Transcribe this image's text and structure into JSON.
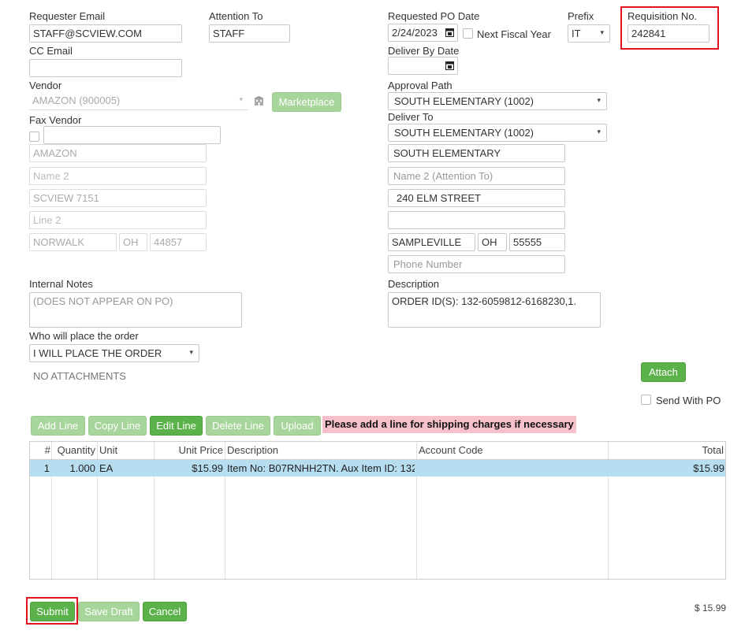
{
  "requester": {
    "email_label": "Requester Email",
    "email_value": "STAFF@SCVIEW.COM",
    "cc_label": "CC Email",
    "cc_value": ""
  },
  "attention": {
    "label": "Attention To",
    "value": "STAFF"
  },
  "po_date": {
    "label": "Requested PO Date",
    "value": "2/24/2023",
    "next_fiscal_label": "Next Fiscal Year"
  },
  "prefix": {
    "label": "Prefix",
    "value": "IT"
  },
  "requisition": {
    "label": "Requisition No.",
    "value": "242841"
  },
  "deliver_by": {
    "label": "Deliver By Date",
    "value": ""
  },
  "vendor": {
    "label": "Vendor",
    "value": "AMAZON (900005)",
    "marketplace_label": "Marketplace",
    "fax_label": "Fax Vendor",
    "fax_value": "",
    "name": "AMAZON",
    "name2_placeholder": "Name 2",
    "line1": "SCVIEW 7151",
    "line2_placeholder": "Line 2",
    "city": "NORWALK",
    "state": "OH",
    "zip": "44857"
  },
  "approval": {
    "label": "Approval Path",
    "value": "SOUTH ELEMENTARY (1002)"
  },
  "deliver_to": {
    "label": "Deliver To",
    "value": "SOUTH ELEMENTARY (1002)",
    "name": "SOUTH ELEMENTARY",
    "name2_placeholder": "Name 2 (Attention To)",
    "line1": "240 ELM STREET",
    "line2": "",
    "city": "SAMPLEVILLE",
    "state": "OH",
    "zip": "55555",
    "phone_placeholder": "Phone Number"
  },
  "notes": {
    "label": "Internal Notes",
    "placeholder": "(DOES NOT APPEAR ON PO)"
  },
  "description": {
    "label": "Description",
    "value": "ORDER ID(S): 132-6059812-6168230,1."
  },
  "order_placer": {
    "label": "Who will place the order",
    "value": "I WILL PLACE THE ORDER"
  },
  "attachments": {
    "text": "NO ATTACHMENTS",
    "attach_label": "Attach",
    "send_with_po_label": "Send With PO"
  },
  "line_actions": {
    "add": "Add Line",
    "copy": "Copy Line",
    "edit": "Edit Line",
    "delete": "Delete Line",
    "upload": "Upload",
    "notice": "Please add a line for shipping charges if necessary"
  },
  "table": {
    "headers": {
      "num": "#",
      "qty": "Quantity",
      "unit": "Unit",
      "price": "Unit Price",
      "desc": "Description",
      "account": "Account Code",
      "total": "Total"
    },
    "rows": [
      {
        "num": "1",
        "qty": "1.000",
        "unit": "EA",
        "price": "$15.99",
        "desc": "Item No: B07RNHH2TN. Aux Item ID: 132...",
        "account": "",
        "total": "$15.99"
      }
    ]
  },
  "footer": {
    "submit": "Submit",
    "save_draft": "Save Draft",
    "cancel": "Cancel",
    "grand_total": "$ 15.99"
  },
  "colors": {
    "accent_green": "#5cb24a",
    "disabled_green": "#a8d59b",
    "highlight_red": "#e0141e",
    "row_selected": "#b6def0",
    "notice_bg": "#f7c1cb"
  }
}
